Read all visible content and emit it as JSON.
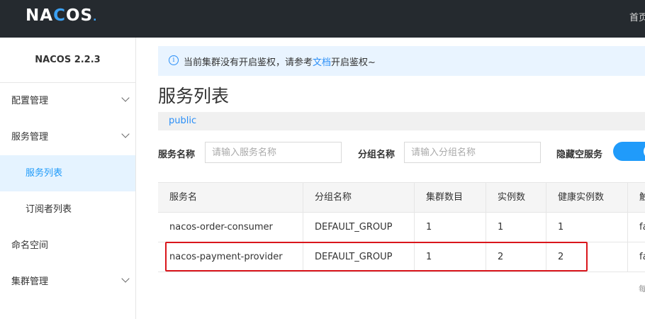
{
  "app": {
    "logo_prefix": "NA",
    "logo_c": "C",
    "logo_os": "OS",
    "logo_dot": ".",
    "nav_right": "首页"
  },
  "sidebar": {
    "version": "NACOS 2.2.3",
    "items": [
      {
        "label": "配置管理"
      },
      {
        "label": "服务管理"
      },
      {
        "label": "服务列表"
      },
      {
        "label": "订阅者列表"
      },
      {
        "label": "命名空间"
      },
      {
        "label": "集群管理"
      }
    ]
  },
  "notice": {
    "before": "当前集群没有开启鉴权，请参考",
    "link": "文档",
    "after": "开启鉴权~",
    "icon": "info-icon"
  },
  "page": {
    "title": "服务列表",
    "namespace": "public"
  },
  "filters": {
    "service_label": "服务名称",
    "service_placeholder": "请输入服务名称",
    "group_label": "分组名称",
    "group_placeholder": "请输入分组名称",
    "hide_empty_label": "隐藏空服务",
    "hide_empty": true
  },
  "table": {
    "headers": [
      "服务名",
      "分组名称",
      "集群数目",
      "实例数",
      "健康实例数",
      "触"
    ],
    "rows": [
      [
        "nacos-order-consumer",
        "DEFAULT_GROUP",
        "1",
        "1",
        "1",
        "fa"
      ],
      [
        "nacos-payment-provider",
        "DEFAULT_GROUP",
        "1",
        "2",
        "2",
        "fa"
      ]
    ]
  },
  "pager": {
    "label": "每"
  },
  "colors": {
    "accent": "#209bfa",
    "topbar": "#252a2f",
    "highlight": "#d9161c"
  }
}
